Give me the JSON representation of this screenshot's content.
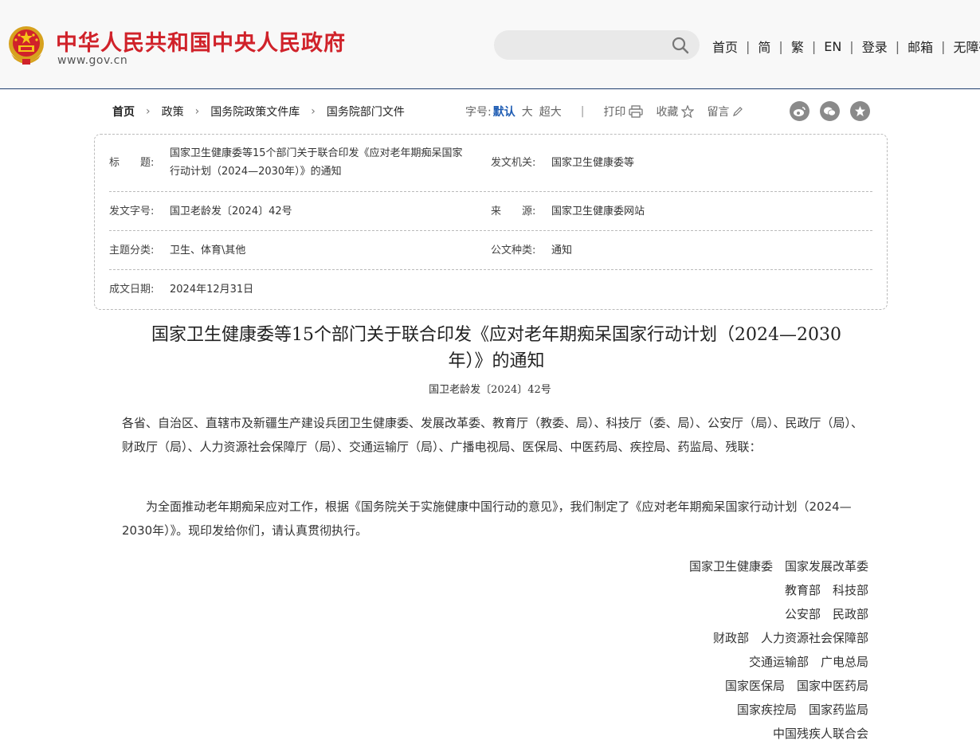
{
  "header": {
    "site_title": "中华人民共和国中央人民政府",
    "site_url": "www.gov.cn",
    "search_placeholder": "",
    "nav": [
      "首页",
      "简",
      "繁",
      "EN",
      "登录",
      "邮箱",
      "无障碍"
    ],
    "brand_color": "#d0222a"
  },
  "breadcrumb": {
    "items": [
      "首页",
      "政策",
      "国务院政策文件库",
      "国务院部门文件"
    ]
  },
  "tools": {
    "font_size_label": "字号:",
    "font_default": "默认",
    "font_large": "大",
    "font_xlarge": "超大",
    "print": "打印",
    "favorite": "收藏",
    "comment": "留言",
    "share_icons": [
      "weibo-icon",
      "wechat-icon",
      "star-share-icon"
    ]
  },
  "info": {
    "title_label": "标　　题:",
    "title_value_line1": "国家卫生健康委等15个部门关于联合印发《应对老年期痴呆国家",
    "title_value_line2": "行动计划（2024—2030年）》的通知",
    "issuer_label": "发文机关:",
    "issuer_value": "国家卫生健康委等",
    "doc_no_label": "发文字号:",
    "doc_no_value": "国卫老龄发〔2024〕42号",
    "source_label": "来　　源:",
    "source_value": "国家卫生健康委网站",
    "topic_label": "主题分类:",
    "topic_value": "卫生、体育\\其他",
    "type_label": "公文种类:",
    "type_value": "通知",
    "date_label": "成文日期:",
    "date_value": "2024年12月31日"
  },
  "article": {
    "title_line1": "国家卫生健康委等15个部门关于联合印发《应对老年期痴呆国家行动计划（2024—2030",
    "title_line2": "年）》的通知",
    "doc_no": "国卫老龄发〔2024〕42号",
    "addressee": "各省、自治区、直辖市及新疆生产建设兵团卫生健康委、发展改革委、教育厅（教委、局）、科技厅（委、局）、公安厅（局）、民政厅（局）、财政厅（局）、人力资源社会保障厅（局）、交通运输厅（局）、广播电视局、医保局、中医药局、疾控局、药监局、残联：",
    "body": "为全面推动老年期痴呆应对工作，根据《国务院关于实施健康中国行动的意见》，我们制定了《应对老年期痴呆国家行动计划（2024—2030年）》。现印发给你们，请认真贯彻执行。",
    "signatories": [
      "国家卫生健康委　国家发展改革委",
      "教育部　科技部",
      "公安部　民政部",
      "财政部　人力资源社会保障部",
      "交通运输部　广电总局",
      "国家医保局　国家中医药局",
      "国家疾控局　国家药监局",
      "中国残疾人联合会"
    ]
  }
}
